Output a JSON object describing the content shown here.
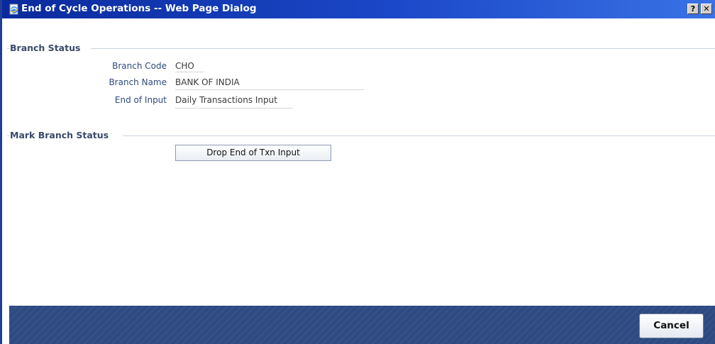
{
  "window": {
    "title": "End of Cycle Operations -- Web Page Dialog",
    "help_label": "?",
    "close_label": "✕"
  },
  "branch_status": {
    "heading": "Branch Status",
    "fields": [
      {
        "label": "Branch Code",
        "value": "CHO"
      },
      {
        "label": "Branch Name",
        "value": "BANK OF INDIA"
      },
      {
        "label": "End of Input",
        "value": "Daily Transactions Input"
      }
    ]
  },
  "mark_branch_status": {
    "heading": "Mark Branch Status",
    "button_label": "Drop End of Txn Input"
  },
  "footer": {
    "cancel_label": "Cancel"
  },
  "colors": {
    "titlebar": "#0a2a9c",
    "footer": "#2e4a82",
    "label_text": "#2d4a7a"
  },
  "icons": {
    "title_icon": "ie-page-icon"
  }
}
